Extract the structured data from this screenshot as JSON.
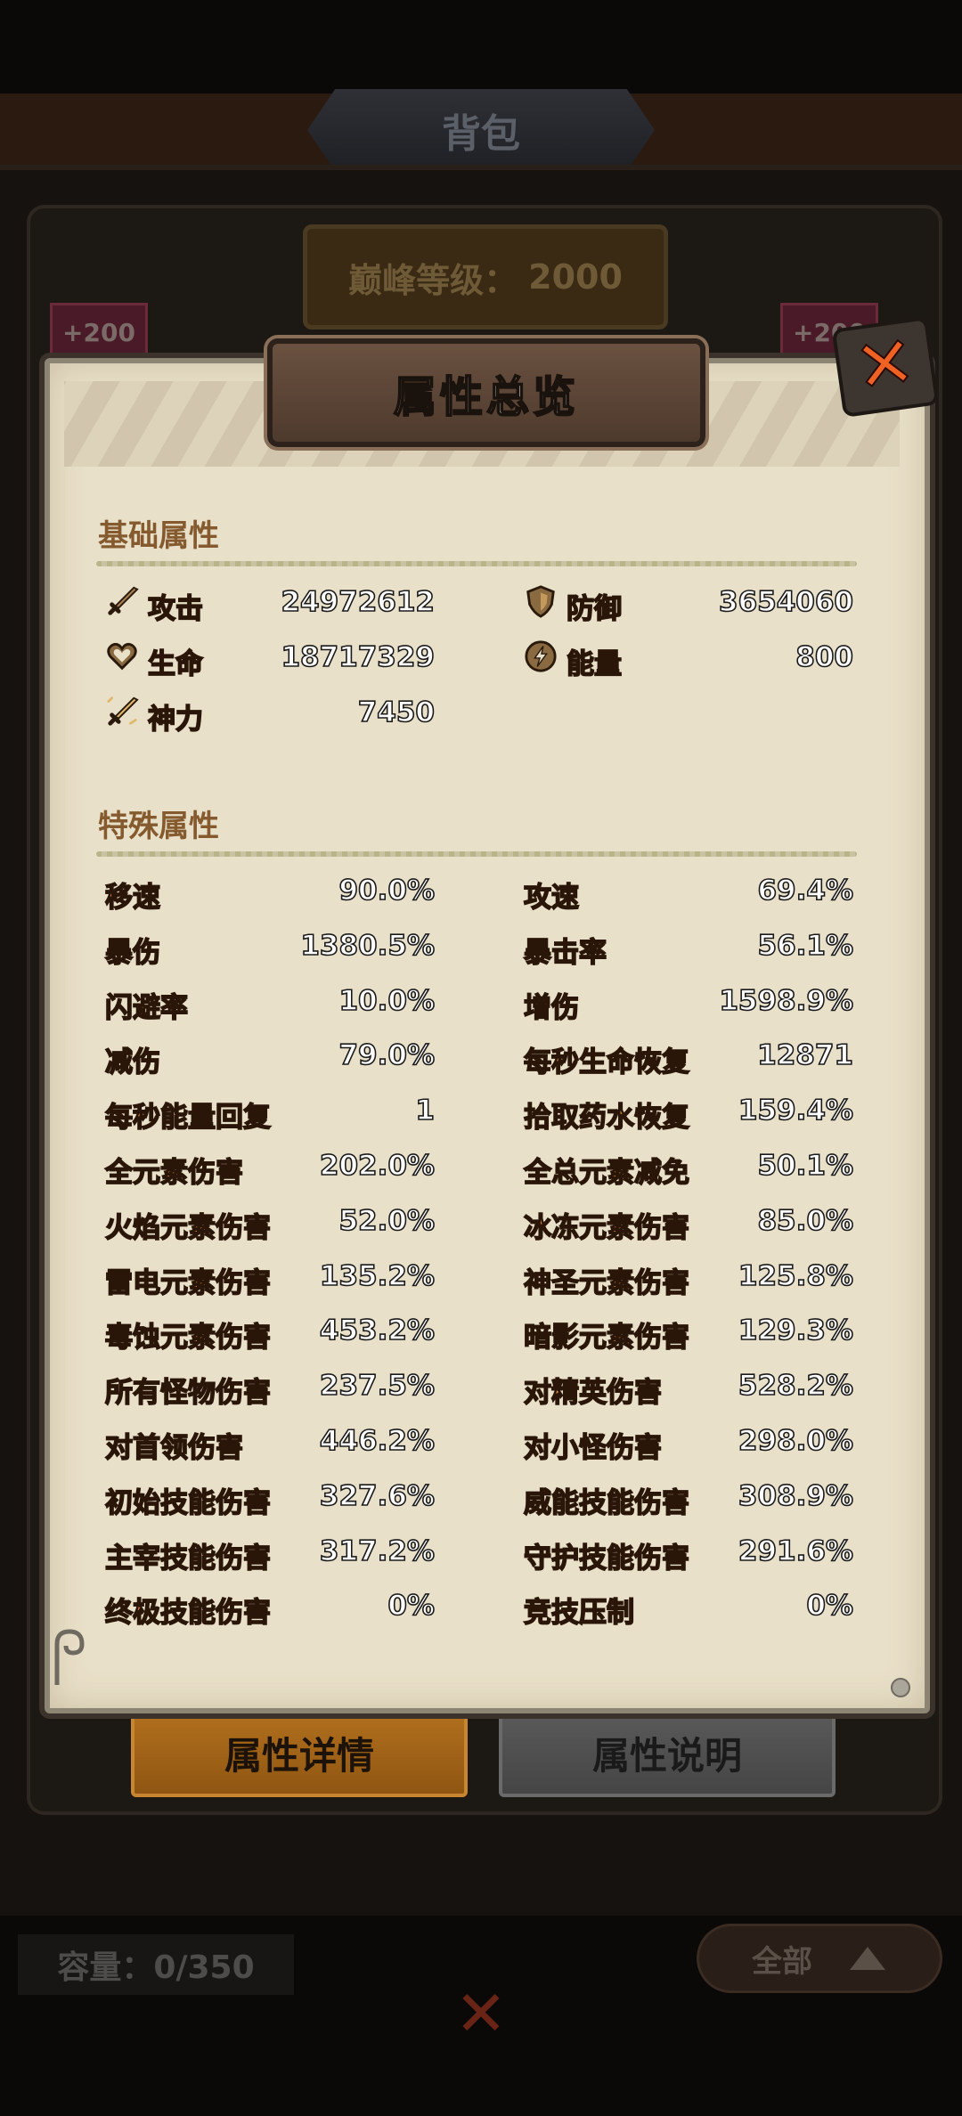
{
  "background": {
    "tab_title": "背包",
    "peak_level_label": "巅峰等级：",
    "peak_level_value": "2000",
    "slot_badge_left": "+200",
    "slot_badge_right": "+200",
    "capacity": "容量：0/350",
    "filter_label": "全部",
    "filter_icon": "triangle-up-icon"
  },
  "modal": {
    "title": "属性总览",
    "basic_section_title": "基础属性",
    "special_section_title": "特殊属性",
    "basic_stats": [
      {
        "icon": "sword-icon",
        "label": "攻击",
        "value": "24972612"
      },
      {
        "icon": "shield-icon",
        "label": "防御",
        "value": "3654060"
      },
      {
        "icon": "heart-icon",
        "label": "生命",
        "value": "18717329"
      },
      {
        "icon": "lightning-icon",
        "label": "能量",
        "value": "800"
      },
      {
        "icon": "divine-sword-icon",
        "label": "神力",
        "value": "7450"
      }
    ],
    "special_stats": [
      {
        "label": "移速",
        "value": "90.0%"
      },
      {
        "label": "攻速",
        "value": "69.4%"
      },
      {
        "label": "暴伤",
        "value": "1380.5%"
      },
      {
        "label": "暴击率",
        "value": "56.1%"
      },
      {
        "label": "闪避率",
        "value": "10.0%"
      },
      {
        "label": "增伤",
        "value": "1598.9%"
      },
      {
        "label": "减伤",
        "value": "79.0%"
      },
      {
        "label": "每秒生命恢复",
        "value": "12871"
      },
      {
        "label": "每秒能量回复",
        "value": "1"
      },
      {
        "label": "拾取药水恢复",
        "value": "159.4%"
      },
      {
        "label": "全元素伤害",
        "value": "202.0%"
      },
      {
        "label": "全总元素减免",
        "value": "50.1%"
      },
      {
        "label": "火焰元素伤害",
        "value": "52.0%"
      },
      {
        "label": "冰冻元素伤害",
        "value": "85.0%"
      },
      {
        "label": "雷电元素伤害",
        "value": "135.2%"
      },
      {
        "label": "神圣元素伤害",
        "value": "125.8%"
      },
      {
        "label": "毒蚀元素伤害",
        "value": "453.2%"
      },
      {
        "label": "暗影元素伤害",
        "value": "129.3%"
      },
      {
        "label": "所有怪物伤害",
        "value": "237.5%"
      },
      {
        "label": "对精英伤害",
        "value": "528.2%"
      },
      {
        "label": "对首领伤害",
        "value": "446.2%"
      },
      {
        "label": "对小怪伤害",
        "value": "298.0%"
      },
      {
        "label": "初始技能伤害",
        "value": "327.6%"
      },
      {
        "label": "威能技能伤害",
        "value": "308.9%"
      },
      {
        "label": "主宰技能伤害",
        "value": "317.2%"
      },
      {
        "label": "守护技能伤害",
        "value": "291.6%"
      },
      {
        "label": "终极技能伤害",
        "value": "0%"
      },
      {
        "label": "竞技压制",
        "value": "0%"
      }
    ]
  },
  "buttons": {
    "detail": "属性详情",
    "explain": "属性说明"
  },
  "colors": {
    "label_orange": "#f3973a",
    "section_brown": "#845a2e",
    "close_orange": "#f06224"
  }
}
